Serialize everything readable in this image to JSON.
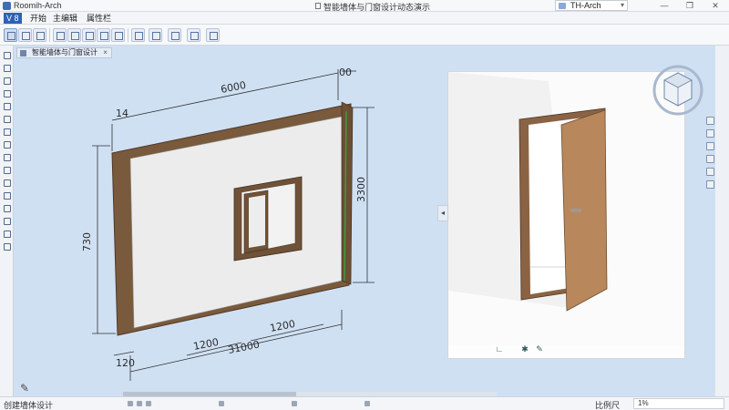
{
  "window": {
    "app_title": "Roomih-Arch",
    "doc_title": "智能墙体与门窗设计动态演示",
    "profile": "TH-Arch",
    "controls": [
      "—",
      "❐",
      "✕"
    ]
  },
  "menu": {
    "items": [
      "V 8",
      "开始",
      "主编辑",
      "属性栏"
    ]
  },
  "canvas": {
    "tab_label": "智能墙体与门窗设计",
    "tab_close": "×"
  },
  "dimensions": {
    "wall_length": "6000",
    "wall_thickness_top": "14",
    "corner_label": "00",
    "wall_height_left": "730",
    "wall_height_right": "3300",
    "window_width": "1200",
    "window_offset": "1200",
    "bottom_length": "31000",
    "bottom_left": "120"
  },
  "status": {
    "left_text": "创建墙体设计",
    "right_text": "比例尺",
    "scale": "1%"
  },
  "colors": {
    "canvas_bg": "#cfe0f3",
    "wall_face": "#ececec",
    "wood": "#7a5a3c",
    "door": "#b8875c",
    "accent": "#2d62b3"
  },
  "icons": {
    "nav_cube": "view-cube-icon",
    "pencil": "pencil-icon",
    "arrow_left": "collapse-arrow-icon"
  }
}
